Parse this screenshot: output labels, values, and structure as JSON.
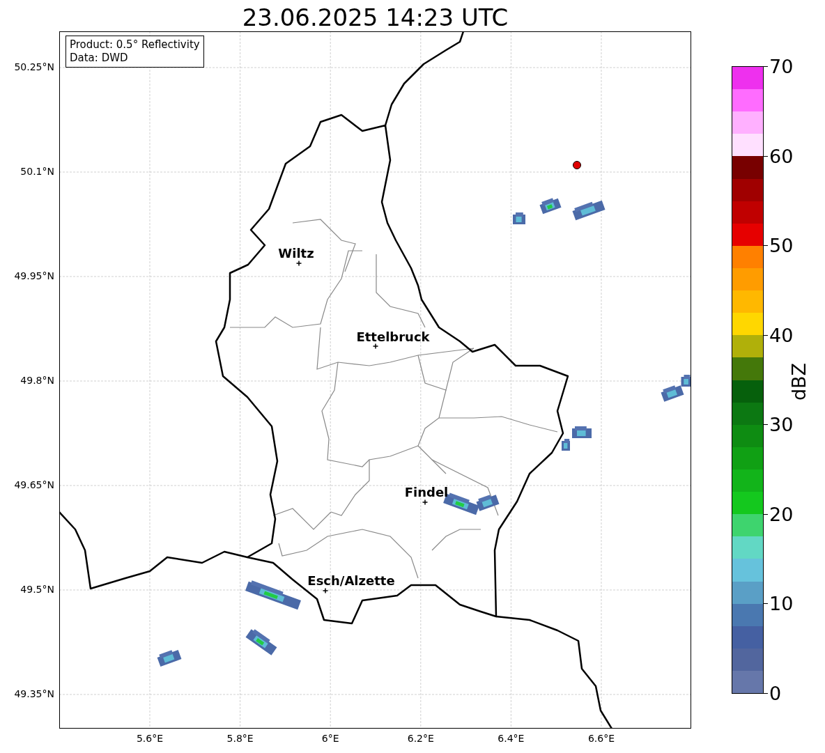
{
  "title": "23.06.2025 14:23 UTC",
  "info_box": {
    "lines": [
      "Product: 0.5° Reflectivity",
      "Data: DWD"
    ]
  },
  "map": {
    "lat_ticks": [
      "50.25°N",
      "50.1°N",
      "49.95°N",
      "49.8°N",
      "49.65°N",
      "49.5°N",
      "49.35°N"
    ],
    "lon_ticks": [
      "5.6°E",
      "5.8°E",
      "6°E",
      "6.2°E",
      "6.4°E",
      "6.6°E"
    ],
    "cities": [
      {
        "name": "Wiltz"
      },
      {
        "name": "Ettelbruck"
      },
      {
        "name": "Findel"
      },
      {
        "name": "Esch/Alzette"
      }
    ]
  },
  "colorbar": {
    "label": "dBZ",
    "ticks": [
      "70",
      "60",
      "50",
      "40",
      "30",
      "20",
      "10",
      "0"
    ],
    "steps": [
      {
        "color": "#ee30ee"
      },
      {
        "color": "#ff6cff"
      },
      {
        "color": "#ffb0ff"
      },
      {
        "color": "#ffe0ff"
      },
      {
        "color": "#780000"
      },
      {
        "color": "#a00000"
      },
      {
        "color": "#c00000"
      },
      {
        "color": "#e60000"
      },
      {
        "color": "#ff8000"
      },
      {
        "color": "#ff9c00"
      },
      {
        "color": "#ffb800"
      },
      {
        "color": "#ffd700"
      },
      {
        "color": "#b0b00a"
      },
      {
        "color": "#44780a"
      },
      {
        "color": "#06600c"
      },
      {
        "color": "#0c7812"
      },
      {
        "color": "#0e8c12"
      },
      {
        "color": "#10a014"
      },
      {
        "color": "#12b41a"
      },
      {
        "color": "#14c81e"
      },
      {
        "color": "#3ed46e"
      },
      {
        "color": "#62d8c4"
      },
      {
        "color": "#66c2dc"
      },
      {
        "color": "#5a9fc6"
      },
      {
        "color": "#4a78b0"
      },
      {
        "color": "#4560a2"
      },
      {
        "color": "#52669e"
      },
      {
        "color": "#6677aa"
      }
    ]
  }
}
